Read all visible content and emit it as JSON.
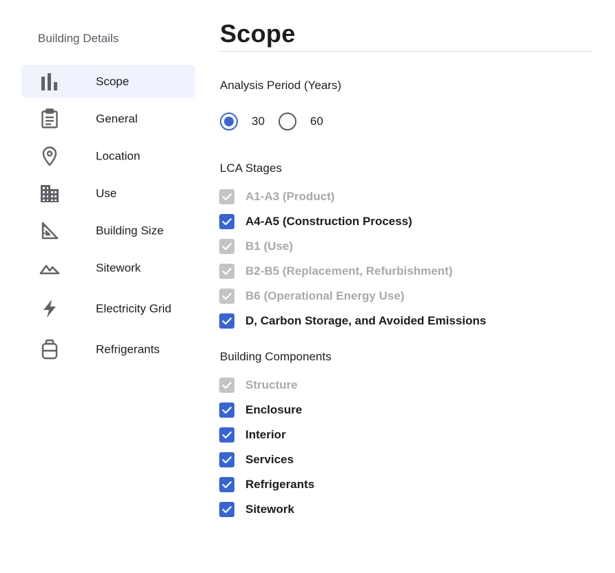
{
  "sidebar": {
    "heading": "Building Details",
    "items": [
      {
        "label": "Scope",
        "icon": "bar-chart-icon",
        "active": true
      },
      {
        "label": "General",
        "icon": "clipboard-icon"
      },
      {
        "label": "Location",
        "icon": "location-pin-icon"
      },
      {
        "label": "Use",
        "icon": "building-icon"
      },
      {
        "label": "Building Size",
        "icon": "set-square-icon"
      },
      {
        "label": "Sitework",
        "icon": "terrain-icon"
      },
      {
        "label": "Electricity Grid",
        "icon": "lightning-icon"
      },
      {
        "label": "Refrigerants",
        "icon": "refrigerant-tank-icon"
      }
    ]
  },
  "main": {
    "title": "Scope",
    "analysis_period": {
      "label": "Analysis Period (Years)",
      "options": [
        {
          "label": "30",
          "selected": true
        },
        {
          "label": "60",
          "selected": false
        }
      ]
    },
    "lca_stages": {
      "label": "LCA Stages",
      "items": [
        {
          "label": "A1-A3 (Product)",
          "checked": true,
          "disabled": true
        },
        {
          "label": "A4-A5 (Construction Process)",
          "checked": true,
          "disabled": false
        },
        {
          "label": "B1 (Use)",
          "checked": true,
          "disabled": true
        },
        {
          "label": "B2-B5 (Replacement, Refurbishment)",
          "checked": true,
          "disabled": true
        },
        {
          "label": "B6 (Operational Energy Use)",
          "checked": true,
          "disabled": true
        },
        {
          "label": "D, Carbon Storage, and Avoided Emissions",
          "checked": true,
          "disabled": false
        }
      ]
    },
    "building_components": {
      "label": "Building Components",
      "items": [
        {
          "label": "Structure",
          "checked": true,
          "disabled": true
        },
        {
          "label": "Enclosure",
          "checked": true,
          "disabled": false
        },
        {
          "label": "Interior",
          "checked": true,
          "disabled": false
        },
        {
          "label": "Services",
          "checked": true,
          "disabled": false
        },
        {
          "label": "Refrigerants",
          "checked": true,
          "disabled": false
        },
        {
          "label": "Sitework",
          "checked": true,
          "disabled": false
        }
      ]
    }
  },
  "colors": {
    "accent": "#3764d6",
    "active_nav_bg": "#eef3fd",
    "disabled": "#c4c4c4",
    "icon_gray": "#5f6368"
  }
}
